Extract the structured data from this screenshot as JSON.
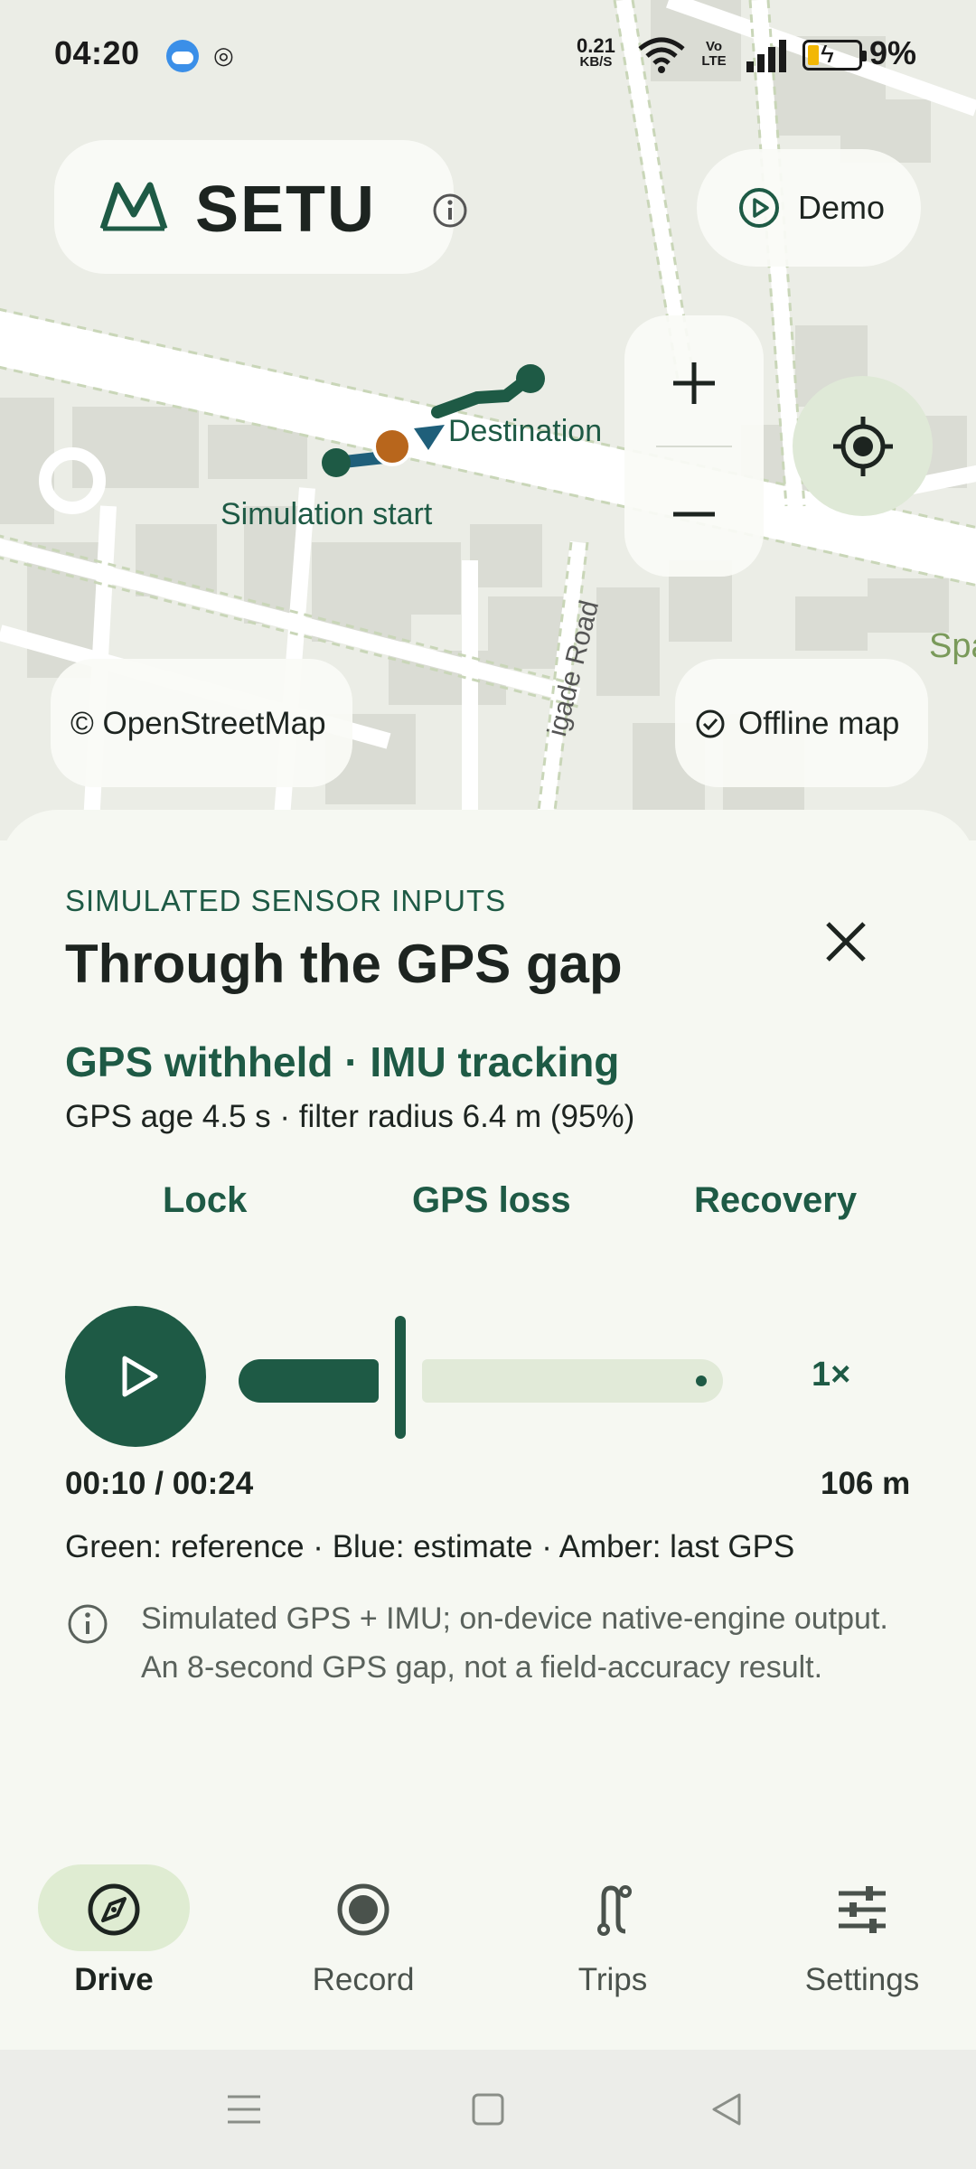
{
  "status_bar": {
    "time": "04:20",
    "net_speed_value": "0.21",
    "net_speed_unit": "KB/S",
    "volte": "Vo LTE",
    "battery_pct": "9%"
  },
  "brand": {
    "name": "SETU"
  },
  "demo": {
    "label": "Demo"
  },
  "map": {
    "label_start": "Simulation start",
    "label_destination": "Destination",
    "road_name": "igade Road",
    "partial_label": "Spa",
    "attribution": "© OpenStreetMap",
    "offline_label": "Offline map",
    "colors": {
      "reference": "#1e5a45",
      "estimate": "#1f5f7a",
      "last_gps": "#b8661c"
    }
  },
  "sheet": {
    "eyebrow": "SIMULATED SENSOR INPUTS",
    "title": "Through the GPS gap",
    "status": "GPS withheld · IMU tracking",
    "detail": "GPS age 4.5 s · filter radius 6.4 m (95%)",
    "phases": [
      "Lock",
      "GPS loss",
      "Recovery"
    ],
    "playback": {
      "progress": 0.42,
      "speed": "1×",
      "time": "00:10 / 00:24",
      "distance": "106 m"
    },
    "legend": "Green: reference · Blue: estimate · Amber: last GPS",
    "note": "Simulated GPS + IMU; on-device native-engine output. An 8-second GPS gap, not a field-accuracy result."
  },
  "nav": {
    "items": [
      {
        "label": "Drive",
        "icon": "compass-icon",
        "active": true
      },
      {
        "label": "Record",
        "icon": "record-icon",
        "active": false
      },
      {
        "label": "Trips",
        "icon": "route-icon",
        "active": false
      },
      {
        "label": "Settings",
        "icon": "sliders-icon",
        "active": false
      }
    ]
  }
}
